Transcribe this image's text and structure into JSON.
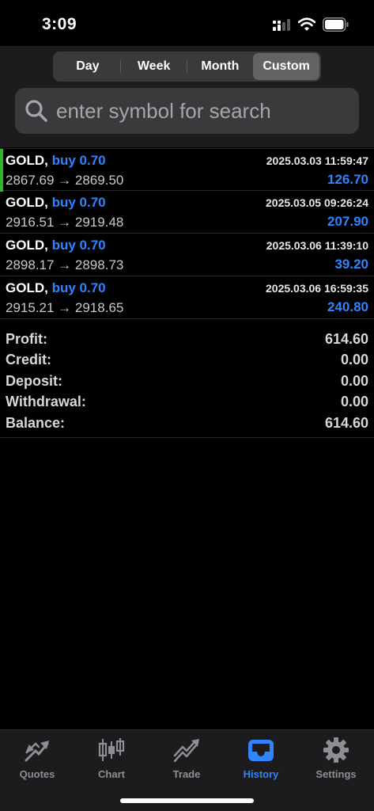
{
  "status_bar": {
    "time": "3:09"
  },
  "header": {
    "period_tabs": [
      {
        "label": "Day",
        "selected": false
      },
      {
        "label": "Week",
        "selected": false
      },
      {
        "label": "Month",
        "selected": false
      },
      {
        "label": "Custom",
        "selected": true
      }
    ],
    "search": {
      "placeholder": "enter symbol for search",
      "value": ""
    }
  },
  "trades": [
    {
      "symbol": "GOLD,",
      "side": "buy 0.70",
      "prices": "2867.69 → 2869.50",
      "time": "2025.03.03 11:59:47",
      "profit": "126.70"
    },
    {
      "symbol": "GOLD,",
      "side": "buy 0.70",
      "prices": "2916.51 → 2919.48",
      "time": "2025.03.05 09:26:24",
      "profit": "207.90"
    },
    {
      "symbol": "GOLD,",
      "side": "buy 0.70",
      "prices": "2898.17 → 2898.73",
      "time": "2025.03.06 11:39:10",
      "profit": "39.20"
    },
    {
      "symbol": "GOLD,",
      "side": "buy 0.70",
      "prices": "2915.21 → 2918.65",
      "time": "2025.03.06 16:59:35",
      "profit": "240.80"
    }
  ],
  "summary": [
    {
      "label": "Profit:",
      "value": "614.60"
    },
    {
      "label": "Credit:",
      "value": "0.00"
    },
    {
      "label": "Deposit:",
      "value": "0.00"
    },
    {
      "label": "Withdrawal:",
      "value": "0.00"
    },
    {
      "label": "Balance:",
      "value": "614.60"
    }
  ],
  "tab_bar": {
    "tabs": [
      {
        "label": "Quotes",
        "icon": "quotes-icon",
        "active": false
      },
      {
        "label": "Chart",
        "icon": "candlestick-chart-icon",
        "active": false
      },
      {
        "label": "Trade",
        "icon": "trade-trend-icon",
        "active": false
      },
      {
        "label": "History",
        "icon": "history-tray-icon",
        "active": true
      },
      {
        "label": "Settings",
        "icon": "gear-icon",
        "active": false
      }
    ]
  },
  "colors": {
    "accent": "#2f84ff",
    "active_marker": "#2fb52f",
    "background": "#000000",
    "panel": "#1c1c1e"
  }
}
